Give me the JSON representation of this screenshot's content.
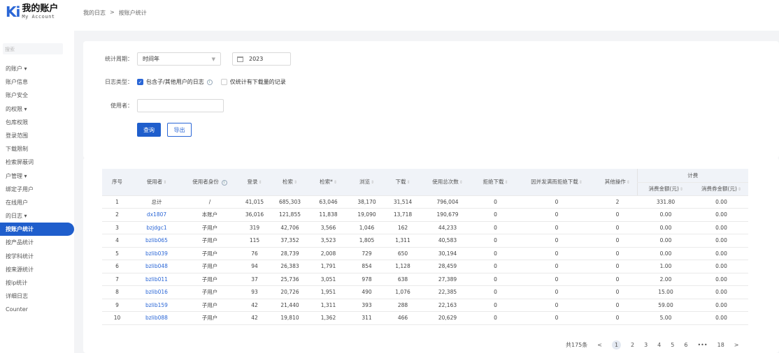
{
  "logo": {
    "mark": "K",
    "accent": "i",
    "title": "我的账户",
    "subtitle": "My Account"
  },
  "breadcrumb": {
    "item1": "我的日志",
    "sep": ">",
    "item2": "按账户统计"
  },
  "sidebar": {
    "search_placeholder": "搜索",
    "items": [
      {
        "label": "的账户 ▾"
      },
      {
        "label": "账户信息"
      },
      {
        "label": "账户安全"
      },
      {
        "label": "的权限 ▾"
      },
      {
        "label": "包库权限"
      },
      {
        "label": "登录范围"
      },
      {
        "label": "下载限制"
      },
      {
        "label": "检索屏蔽词"
      },
      {
        "label": "户管理 ▾"
      },
      {
        "label": "绑定子用户"
      },
      {
        "label": "在线用户"
      },
      {
        "label": "的日志 ▾"
      },
      {
        "label": "按账户统计",
        "active": true
      },
      {
        "label": "按产品统计"
      },
      {
        "label": "按学科统计"
      },
      {
        "label": "按来源统计"
      },
      {
        "label": "按ip统计"
      },
      {
        "label": "详细日志"
      },
      {
        "label": "Counter"
      }
    ]
  },
  "filters": {
    "period_label": "统计周期：",
    "period_value": "时间年",
    "year_value": "2023",
    "logtype_label": "日志类型：",
    "include_sub_label": "包含子/其他用户的日志",
    "download_only_label": "仅统计有下载量的记录",
    "user_label": "使用者：",
    "user_value": "",
    "query_button": "查询",
    "export_button": "导出"
  },
  "table": {
    "headers": {
      "idx": "序号",
      "user": "使用者",
      "role": "使用者身份",
      "login": "登录",
      "search": "检索",
      "search2": "检索*",
      "browse": "浏览",
      "download": "下载",
      "total": "使用总次数",
      "refuse": "拒绝下载",
      "refuse_concurrent": "因并发满而拒绝下载",
      "other": "其他操作",
      "billing": "计费",
      "consume_amount": "消费金额(元)",
      "coupon_amount": "消费券金额(元)"
    },
    "rows": [
      {
        "idx": "1",
        "user": "总计",
        "role": "/",
        "login": "41,015",
        "search": "685,303",
        "search2": "63,046",
        "browse": "38,170",
        "download": "31,514",
        "total": "796,004",
        "refuse": "0",
        "refuse_c": "0",
        "other": "2",
        "amount": "331.80",
        "coupon": "0.00",
        "link": false
      },
      {
        "idx": "2",
        "user": "dx1807",
        "role": "本账户",
        "login": "36,016",
        "search": "121,855",
        "search2": "11,838",
        "browse": "19,090",
        "download": "13,718",
        "total": "190,679",
        "refuse": "0",
        "refuse_c": "0",
        "other": "0",
        "amount": "0.00",
        "coupon": "0.00",
        "link": true
      },
      {
        "idx": "3",
        "user": "bzjdgc1",
        "role": "子用户",
        "login": "319",
        "search": "42,706",
        "search2": "3,566",
        "browse": "1,046",
        "download": "162",
        "total": "44,233",
        "refuse": "0",
        "refuse_c": "0",
        "other": "0",
        "amount": "0.00",
        "coupon": "0.00",
        "link": true
      },
      {
        "idx": "4",
        "user": "bzlib065",
        "role": "子用户",
        "login": "115",
        "search": "37,352",
        "search2": "3,523",
        "browse": "1,805",
        "download": "1,311",
        "total": "40,583",
        "refuse": "0",
        "refuse_c": "0",
        "other": "0",
        "amount": "0.00",
        "coupon": "0.00",
        "link": true
      },
      {
        "idx": "5",
        "user": "bzlib039",
        "role": "子用户",
        "login": "76",
        "search": "28,739",
        "search2": "2,008",
        "browse": "729",
        "download": "650",
        "total": "30,194",
        "refuse": "0",
        "refuse_c": "0",
        "other": "0",
        "amount": "0.00",
        "coupon": "0.00",
        "link": true
      },
      {
        "idx": "6",
        "user": "bzlib048",
        "role": "子用户",
        "login": "94",
        "search": "26,383",
        "search2": "1,791",
        "browse": "854",
        "download": "1,128",
        "total": "28,459",
        "refuse": "0",
        "refuse_c": "0",
        "other": "0",
        "amount": "1.00",
        "coupon": "0.00",
        "link": true
      },
      {
        "idx": "7",
        "user": "bzlib011",
        "role": "子用户",
        "login": "37",
        "search": "25,736",
        "search2": "3,051",
        "browse": "978",
        "download": "638",
        "total": "27,389",
        "refuse": "0",
        "refuse_c": "0",
        "other": "0",
        "amount": "2.00",
        "coupon": "0.00",
        "link": true
      },
      {
        "idx": "8",
        "user": "bzlib016",
        "role": "子用户",
        "login": "93",
        "search": "20,726",
        "search2": "1,951",
        "browse": "490",
        "download": "1,076",
        "total": "22,385",
        "refuse": "0",
        "refuse_c": "0",
        "other": "0",
        "amount": "15.00",
        "coupon": "0.00",
        "link": true
      },
      {
        "idx": "9",
        "user": "bzlib159",
        "role": "子用户",
        "login": "42",
        "search": "21,440",
        "search2": "1,311",
        "browse": "393",
        "download": "288",
        "total": "22,163",
        "refuse": "0",
        "refuse_c": "0",
        "other": "0",
        "amount": "59.00",
        "coupon": "0.00",
        "link": true
      },
      {
        "idx": "10",
        "user": "bzlib088",
        "role": "子用户",
        "login": "42",
        "search": "19,810",
        "search2": "1,362",
        "browse": "311",
        "download": "466",
        "total": "20,629",
        "refuse": "0",
        "refuse_c": "0",
        "other": "0",
        "amount": "5.00",
        "coupon": "0.00",
        "link": true
      }
    ]
  },
  "pagination": {
    "total": "共175条",
    "prev": "<",
    "pages": [
      "1",
      "2",
      "3",
      "4",
      "5",
      "6"
    ],
    "ellipsis": "•••",
    "last": "18",
    "next": ">"
  },
  "colors": {
    "primary": "#1f5ecc",
    "link": "#2a66d6",
    "page_bg": "#f3f4f6"
  }
}
